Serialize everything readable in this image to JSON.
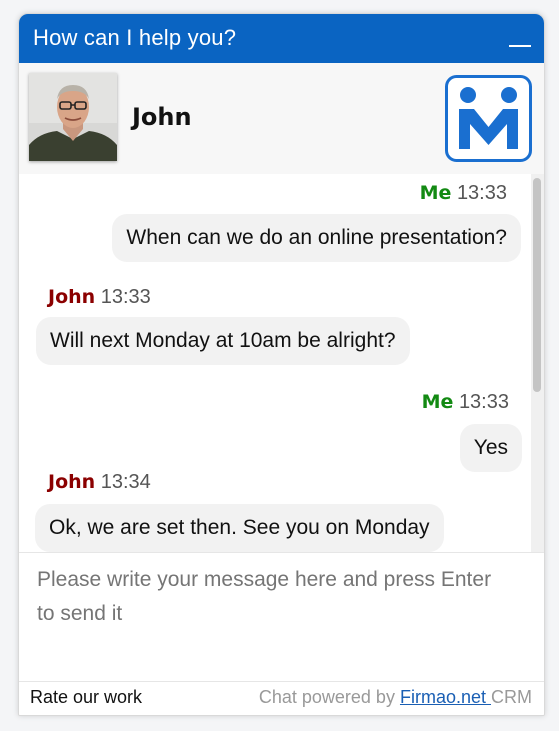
{
  "header": {
    "title": "How can I help you?"
  },
  "agent": {
    "name": "John"
  },
  "messages": [
    {
      "sender": "Me",
      "time": "13:33",
      "text": "When can we do an online presentation?"
    },
    {
      "sender": "John",
      "time": "13:33",
      "text": "Will next Monday at 10am be alright?"
    },
    {
      "sender": "Me",
      "time": "13:33",
      "text": "Yes"
    },
    {
      "sender": "John",
      "time": "13:34",
      "text": "Ok, we are set then. See you on Monday"
    }
  ],
  "compose": {
    "placeholder": "Please write your message here and press Enter to send it"
  },
  "footer": {
    "rate_label": "Rate our work",
    "powered_prefix": "Chat powered by",
    "powered_link": "Firmao.net ",
    "powered_suffix": "CRM"
  },
  "colors": {
    "header_bg": "#0a64c2",
    "me_name": "#138a13",
    "agent_name": "#8b0000"
  },
  "icons": [
    "minimize-icon",
    "agent-avatar",
    "company-logo"
  ]
}
